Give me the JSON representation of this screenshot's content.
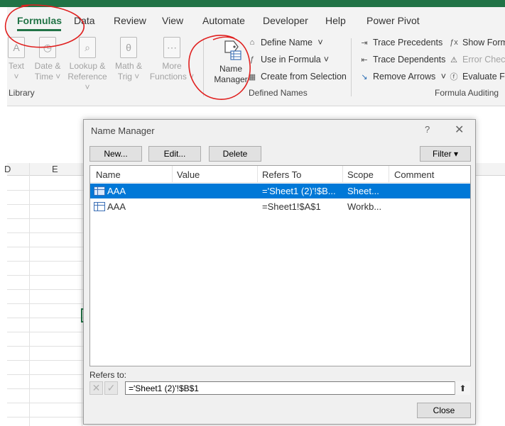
{
  "ribbon": {
    "tabs": [
      "Formulas",
      "Data",
      "Review",
      "View",
      "Automate",
      "Developer",
      "Help",
      "Power Pivot"
    ],
    "active_tab": "Formulas",
    "library": {
      "buttons": [
        {
          "label1": "Text",
          "label2": ""
        },
        {
          "label1": "Date &",
          "label2": "Time"
        },
        {
          "label1": "Lookup &",
          "label2": "Reference"
        },
        {
          "label1": "Math &",
          "label2": "Trig"
        },
        {
          "label1": "More",
          "label2": "Functions"
        }
      ],
      "group_label": "Library"
    },
    "defined_names": {
      "name_manager_line1": "Name",
      "name_manager_line2": "Manager",
      "define_name": "Define Name",
      "use_in_formula": "Use in Formula",
      "create_from_selection": "Create from Selection",
      "group_label": "Defined Names"
    },
    "formula_auditing": {
      "trace_precedents": "Trace Precedents",
      "trace_dependents": "Trace Dependents",
      "remove_arrows": "Remove Arrows",
      "show_formulas": "Show Form",
      "error_checking": "Error Check",
      "evaluate_formula": "Evaluate Fo",
      "group_label": "Formula Auditing"
    }
  },
  "sheet": {
    "visible_column": "E",
    "partial_column": "D"
  },
  "dialog": {
    "title": "Name Manager",
    "help": "?",
    "close_x": "✕",
    "new_btn": "New...",
    "edit_btn": "Edit...",
    "delete_btn": "Delete",
    "filter_btn": "Filter ▾",
    "columns": [
      "Name",
      "Value",
      "Refers To",
      "Scope",
      "Comment"
    ],
    "rows": [
      {
        "name": "AAA",
        "value": "",
        "refers_to": "='Sheet1 (2)'!$B...",
        "scope": "Sheet...",
        "comment": "",
        "selected": true
      },
      {
        "name": "AAA",
        "value": "",
        "refers_to": "=Sheet1!$A$1",
        "scope": "Workb...",
        "comment": "",
        "selected": false
      }
    ],
    "refers_to_label": "Refers to:",
    "refers_to_value": "='Sheet1 (2)'!$B$1",
    "close_btn": "Close"
  },
  "colors": {
    "accent": "#217346",
    "selection": "#0078d7",
    "annotation": "#e0201f"
  }
}
